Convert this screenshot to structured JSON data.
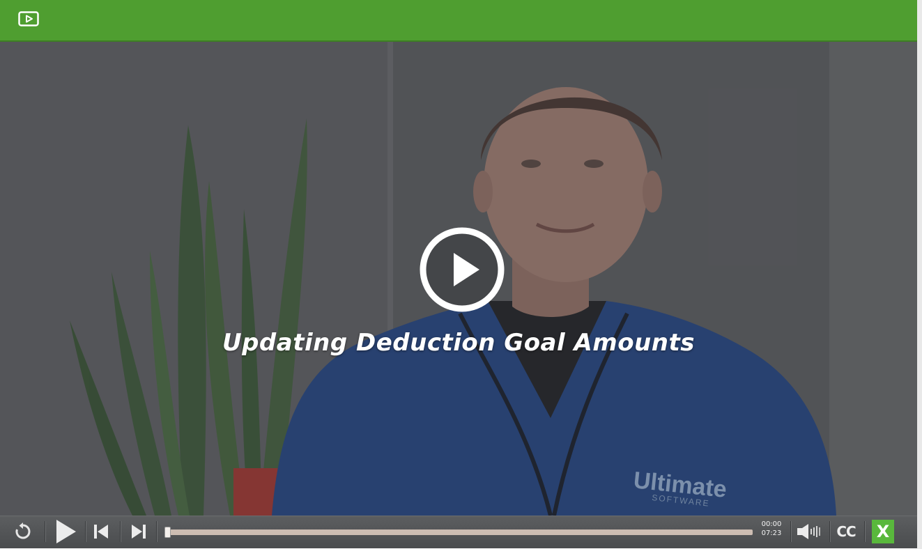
{
  "header": {
    "app_icon": "video-player-icon",
    "color": "#4f9e30"
  },
  "video": {
    "title": "Updating Deduction Goal Amounts",
    "shirt_logo_line1": "Ultimate",
    "shirt_logo_line2": "SOFTWARE",
    "big_play_icon": "play-circle-icon"
  },
  "controls": {
    "replay_icon": "replay-icon",
    "play_icon": "play-icon",
    "prev_icon": "skip-back-icon",
    "next_icon": "skip-forward-icon",
    "progress": 0.0,
    "current_time": "00:00",
    "duration": "07:23",
    "volume_icon": "volume-icon",
    "cc_label": "CC",
    "close_label": "X",
    "accent": "#59b83c"
  }
}
